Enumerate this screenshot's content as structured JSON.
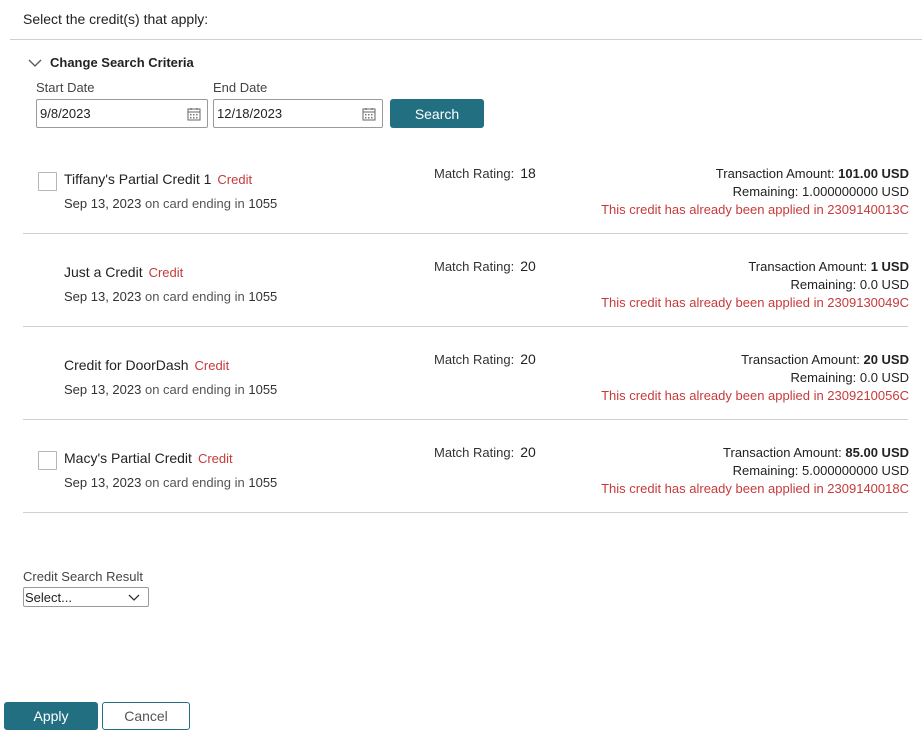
{
  "heading": "Select the credit(s) that apply:",
  "criteria": {
    "toggle_label": "Change Search Criteria",
    "start_label": "Start Date",
    "start_value": "9/8/2023",
    "end_label": "End Date",
    "end_value": "12/18/2023",
    "search_label": "Search"
  },
  "credits": [
    {
      "title": "Tiffany's Partial Credit 1",
      "tag": "Credit",
      "date": "Sep 13, 2023",
      "card_text": "on card ending in",
      "card_last4": "1055",
      "match_label": "Match Rating:",
      "match_value": "18",
      "amount_label": "Transaction Amount:",
      "amount_value": "101.00 USD",
      "remaining": "Remaining: 1.000000000 USD",
      "applied_note": "This credit has already been applied in 2309140013C"
    },
    {
      "title": "Just a Credit",
      "tag": "Credit",
      "date": "Sep 13, 2023",
      "card_text": "on card ending in",
      "card_last4": "1055",
      "match_label": "Match Rating:",
      "match_value": "20",
      "amount_label": "Transaction Amount:",
      "amount_value": "1 USD",
      "remaining": "Remaining: 0.0 USD",
      "applied_note": "This credit has already been applied in 2309130049C"
    },
    {
      "title": "Credit for DoorDash",
      "tag": "Credit",
      "date": "Sep 13, 2023",
      "card_text": "on card ending in",
      "card_last4": "1055",
      "match_label": "Match Rating:",
      "match_value": "20",
      "amount_label": "Transaction Amount:",
      "amount_value": "20 USD",
      "remaining": "Remaining: 0.0 USD",
      "applied_note": "This credit has already been applied in 2309210056C"
    },
    {
      "title": "Macy's Partial Credit",
      "tag": "Credit",
      "date": "Sep 13, 2023",
      "card_text": "on card ending in",
      "card_last4": "1055",
      "match_label": "Match Rating:",
      "match_value": "20",
      "amount_label": "Transaction Amount:",
      "amount_value": "85.00 USD",
      "remaining": "Remaining: 5.000000000 USD",
      "applied_note": "This credit has already been applied in 2309140018C"
    }
  ],
  "result": {
    "label": "Credit Search Result",
    "selected": "Select..."
  },
  "footer": {
    "apply_label": "Apply",
    "cancel_label": "Cancel"
  }
}
